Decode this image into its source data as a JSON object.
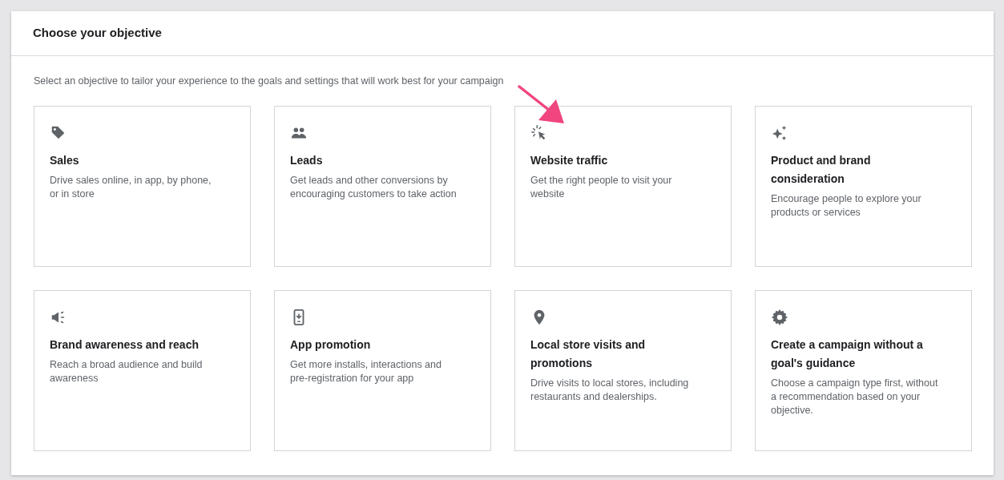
{
  "panel": {
    "title": "Choose your objective",
    "intro": "Select an objective to tailor your experience to the goals and settings that will work best for your campaign"
  },
  "objectives": [
    {
      "title": "Sales",
      "description": "Drive sales online, in app, by phone, or in store"
    },
    {
      "title": "Leads",
      "description": "Get leads and other conversions by encouraging customers to take action"
    },
    {
      "title": "Website traffic",
      "description": "Get the right people to visit your website"
    },
    {
      "title": "Product and brand consideration",
      "description": "Encourage people to explore your products or services"
    },
    {
      "title": "Brand awareness and reach",
      "description": "Reach a broad audience and build awareness"
    },
    {
      "title": "App promotion",
      "description": "Get more installs, interactions and pre-registration for your app"
    },
    {
      "title": "Local store visits and promotions",
      "description": "Drive visits to local stores, including restaurants and dealerships."
    },
    {
      "title": "Create a campaign without a goal's guidance",
      "description": "Choose a campaign type first, without a recommendation based on your objective."
    }
  ]
}
